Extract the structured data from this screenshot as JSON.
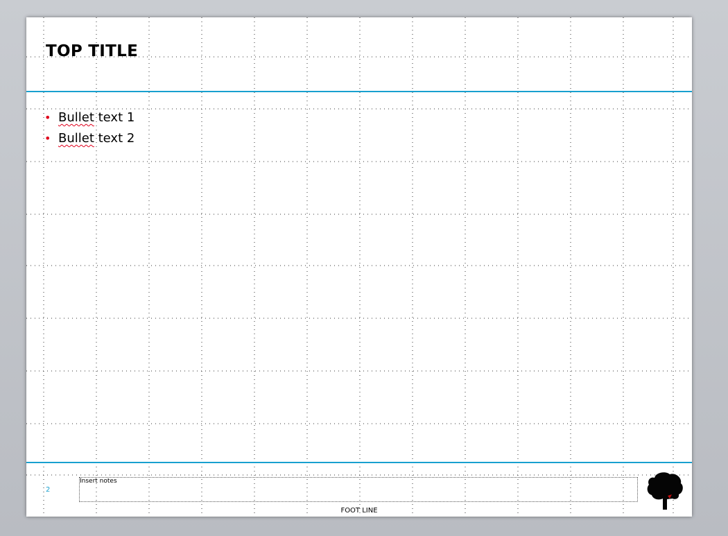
{
  "slide": {
    "title": "TOP TITLE",
    "bullets": [
      {
        "first": "Bullet",
        "rest": " text 1"
      },
      {
        "first": "Bullet",
        "rest": " text 2"
      }
    ],
    "page_number": "2",
    "notes_placeholder": "Insert notes",
    "footer": "FOOT LINE"
  },
  "colors": {
    "rule": "#18a0cf",
    "bullet": "#e0001b",
    "canvas": "#c9ccd1"
  },
  "icons": {
    "logo": "brand-logo-icon"
  }
}
